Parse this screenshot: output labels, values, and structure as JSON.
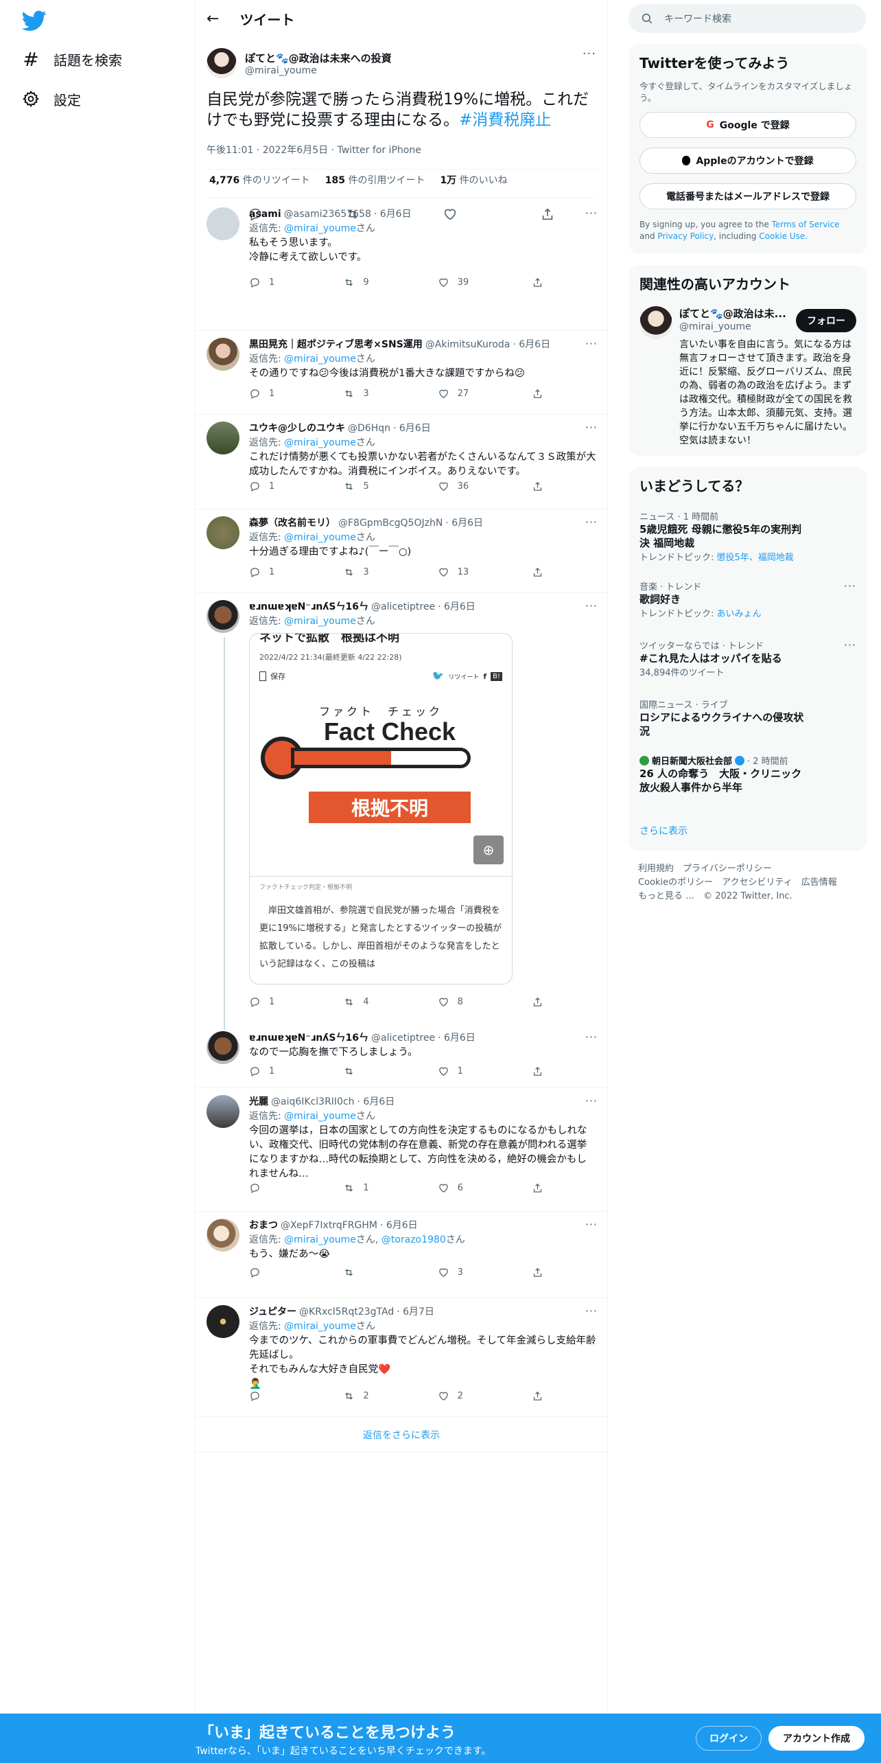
{
  "nav": {
    "explore": "話題を検索",
    "settings": "設定"
  },
  "header": {
    "title": "ツイート"
  },
  "focal": {
    "name": "ぽてと🐾@政治は未来への投資",
    "handle": "@mirai_youme",
    "text": "自民党が参院選で勝ったら消費税19%に増税。これだけでも野党に投票する理由になる。",
    "hashtag": "#消費税廃止",
    "time": "午後11:01 · 2022年6月5日 · Twitter for iPhone",
    "retweets": "4,776",
    "retweets_label": "件のリツイート",
    "quotes": "185",
    "quotes_label": "件の引用ツイート",
    "likes": "1万",
    "likes_label": "件のいいね"
  },
  "replying_prefix": "返信先: ",
  "replying_suffix": "さん",
  "replies": [
    {
      "name": "asami",
      "handle": "@asami23657658",
      "date": "· 6月6日",
      "to": "@mirai_youme",
      "text": "私もそう思います。\n冷静に考えて欲しいです。",
      "reply": "1",
      "rt": "9",
      "like": "39"
    },
    {
      "name": "黒田晃充｜超ポジティブ思考×SNS運用",
      "handle": "@AkimitsuKuroda",
      "date": "· 6月6日",
      "to": "@mirai_youme",
      "text": "その通りですね😕今後は消費税が1番大きな課題ですからね😕",
      "reply": "1",
      "rt": "3",
      "like": "27"
    },
    {
      "name": "ユウキ@少しのユウキ",
      "handle": "@D6Hqn",
      "date": "· 6月6日",
      "to": "@mirai_youme",
      "text": "これだけ情勢が悪くても投票いかない若者がたくさんいるなんて３Ｓ政策が大成功したんですかね。消費税にインボイス。ありえないです。",
      "reply": "1",
      "rt": "5",
      "like": "36"
    },
    {
      "name": "森夢（改名前モリ）",
      "handle": "@F8GpmBcgQ5OJzhN",
      "date": "· 6月6日",
      "to": "@mirai_youme",
      "text": "十分過ぎる理由ですよね♪(￣ー￣○)",
      "reply": "1",
      "rt": "3",
      "like": "13"
    },
    {
      "name": "ɐɹnɯɐʞɐN⁻ɹnʎSㄣ16ㄣ",
      "handle": "@alicetiptree",
      "date": "· 6月6日",
      "to": "@mirai_youme",
      "text": "",
      "reply": "1",
      "rt": "4",
      "like": "8"
    },
    {
      "name": "ɐɹnɯɐʞɐN⁻ɹnʎSㄣ16ㄣ",
      "handle": "@alicetiptree",
      "date": "· 6月6日",
      "to": "",
      "text": "なので一応胸を撫で下ろしましょう。",
      "reply": "1",
      "rt": "",
      "like": "1"
    },
    {
      "name": "光麗",
      "handle": "@aiq6IKcl3RII0ch",
      "date": "· 6月6日",
      "to": "@mirai_youme",
      "text": "今回の選挙は，日本の国家としての方向性を決定するものになるかもしれない、政権交代、旧時代の党体制の存在意義、新党の存在意義が問われる選挙になりますかね…時代の転換期として、方向性を決める，絶好の機会かもしれませんね…",
      "reply": "",
      "rt": "1",
      "like": "6"
    },
    {
      "name": "おまつ",
      "handle": "@XepF7IxtrqFRGHM",
      "date": "· 6月6日",
      "to": "@mirai_youme",
      "to2": "@torazo1980",
      "text": "もう、嫌だあ〜😭",
      "reply": "",
      "rt": "",
      "like": "3"
    },
    {
      "name": "ジュピター",
      "handle": "@KRxcI5Rqt23gTAd",
      "date": "· 6月7日",
      "to": "@mirai_youme",
      "text": "今までのツケ、これからの軍事費でどんどん増税。そして年金減らし支給年齢先延ばし。\nそれでもみんな大好き自民党❤️\n🤦‍♂️",
      "reply": "",
      "rt": "2",
      "like": "2"
    }
  ],
  "show_more_replies": "返信をさらに表示",
  "card": {
    "headline": "ネットで拡散　根拠は不明",
    "date": "2022/4/22 21:34(最終更新 4/22 22:28)",
    "save": "保存",
    "retweet_small": "リツイート",
    "fc_label": "ファクト　チェック",
    "fc_title": "Fact Check",
    "verdict": "根拠不明",
    "caption": "ファクトチェック判定・根拠不明",
    "body": "　岸田文雄首相が、参院選で自民党が勝った場合「消費税を更に19%に増税する」と発言したとするツイッターの投稿が拡散している。しかし、岸田首相がそのような発言をしたという記録はなく、この投稿は"
  },
  "search": {
    "placeholder": "キーワード検索"
  },
  "signup": {
    "title": "Twitterを使ってみよう",
    "desc": "今すぐ登録して、タイムラインをカスタマイズしましょう。",
    "google": "Google で登録",
    "apple": "Appleのアカウントで登録",
    "phone": "電話番号またはメールアドレスで登録",
    "terms_pre": "By signing up, you agree to the ",
    "terms": "Terms of Service",
    "and": " and ",
    "privacy": "Privacy Policy",
    "including": ", including ",
    "cookie": "Cookie Use."
  },
  "related": {
    "title": "関連性の高いアカウント",
    "name": "ぽてと🐾@政治は未...",
    "handle": "@mirai_youme",
    "follow": "フォロー",
    "bio": "言いたい事を自由に言う。気になる方は無言フォローさせて頂きます。政治を身近に！反緊縮、反グローバリズム、庶民の為、弱者の為の政治を広げよう。まずは政権交代。積極財政が全ての国民を救う方法。山本太郎、須藤元気、支持。選挙に行かない五千万ちゃんに届けたい。空気は読まない！"
  },
  "trends": {
    "title": "いまどうしてる？",
    "items": [
      {
        "cat": "ニュース · 1 時間前",
        "t": "5歳児餓死 母親に懲役5年の実刑判決 福岡地裁",
        "sub_pre": "トレンドトピック: ",
        "sub": "懲役5年、福岡地裁"
      },
      {
        "cat": "音楽 · トレンド",
        "t": "歌詞好き",
        "sub_pre": "トレンドトピック: ",
        "sub": "あいみょん"
      },
      {
        "cat": "ツイッターならでは · トレンド",
        "t": "#これ見た人はオッパイを貼る",
        "sub_pre": "",
        "sub": "34,894件のツイート"
      },
      {
        "cat": "国際ニュース · ライブ",
        "t": "ロシアによるウクライナへの侵攻状況",
        "sub_pre": "",
        "sub": ""
      },
      {
        "cat": "朝日新聞大阪社会部",
        "cat2": "· 2 時間前",
        "t": "26 人の命奪う　大阪・クリニック放火殺人事件から半年",
        "sub_pre": "",
        "sub": ""
      }
    ],
    "show_more": "さらに表示"
  },
  "footer": {
    "terms": "利用規約",
    "privacy": "プライバシーポリシー",
    "cookie": "Cookieのポリシー",
    "access": "アクセシビリティ",
    "ads": "広告情報",
    "more": "もっと見る …",
    "copy": "© 2022 Twitter, Inc."
  },
  "bottom": {
    "title": "「いま」起きていることを見つけよう",
    "sub": "Twitterなら、「いま」起きていることをいち早くチェックできます。",
    "login": "ログイン",
    "signup": "アカウント作成"
  },
  "colors": {
    "accent": "#1d9bf0",
    "fc_red": "#e4572e"
  }
}
